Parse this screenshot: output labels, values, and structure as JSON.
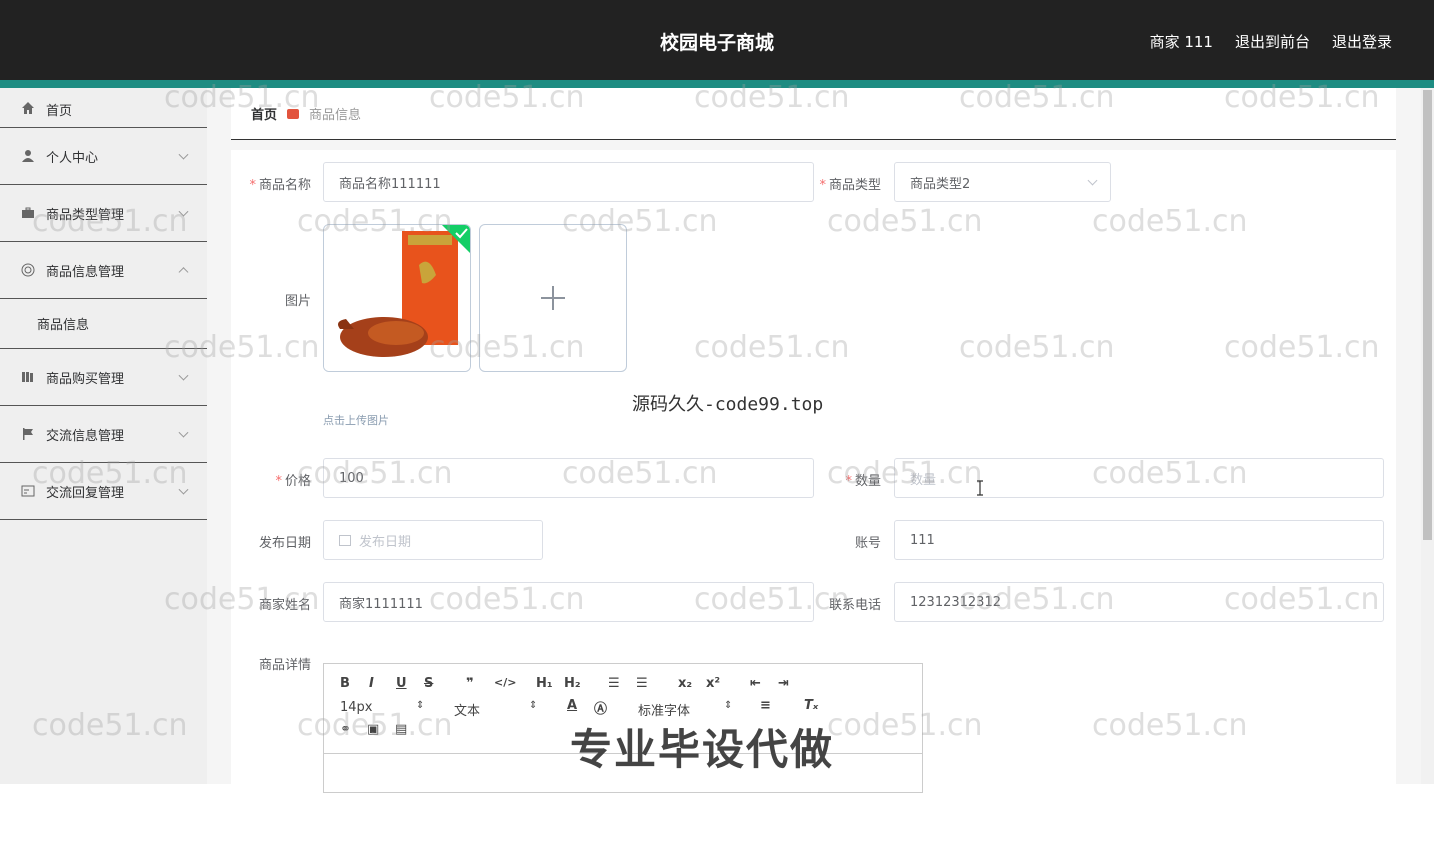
{
  "header": {
    "title": "校园电子商城",
    "nav": [
      "商家 111",
      "退出到前台",
      "退出登录"
    ]
  },
  "sidebar": {
    "items": [
      {
        "label": "首页",
        "icon": "home-icon"
      },
      {
        "label": "个人中心",
        "icon": "user-icon"
      },
      {
        "label": "商品类型管理",
        "icon": "briefcase-icon"
      },
      {
        "label": "商品信息管理",
        "icon": "circle-icon"
      },
      {
        "label": "商品信息",
        "icon": ""
      },
      {
        "label": "商品购买管理",
        "icon": "book-icon"
      },
      {
        "label": "交流信息管理",
        "icon": "flag-icon"
      },
      {
        "label": "交流回复管理",
        "icon": "message-icon"
      }
    ]
  },
  "breadcrumb": {
    "home": "首页",
    "current": "商品信息"
  },
  "form": {
    "name_label": "商品名称",
    "name_value": "商品名称111111",
    "type_label": "商品类型",
    "type_value": "商品类型2",
    "image_label": "图片",
    "upload_tip": "点击上传图片",
    "price_label": "价格",
    "price_value": "100",
    "qty_label": "数量",
    "qty_placeholder": "数量",
    "date_label": "发布日期",
    "date_placeholder": "发布日期",
    "account_label": "账号",
    "account_value": "111",
    "merchant_label": "商家姓名",
    "merchant_value": "商家1111111",
    "phone_label": "联系电话",
    "phone_value": "12312312312",
    "detail_label": "商品详情"
  },
  "editor": {
    "font_size": "14px",
    "text_type": "文本",
    "font_family": "标准字体"
  },
  "overlays": {
    "site": "源码久久-code99.top",
    "banner": "专业毕设代做",
    "watermark": "code51.cn"
  },
  "colors": {
    "header_bg": "#222222",
    "accent": "#1e8c82",
    "required": "#f56c6c"
  }
}
